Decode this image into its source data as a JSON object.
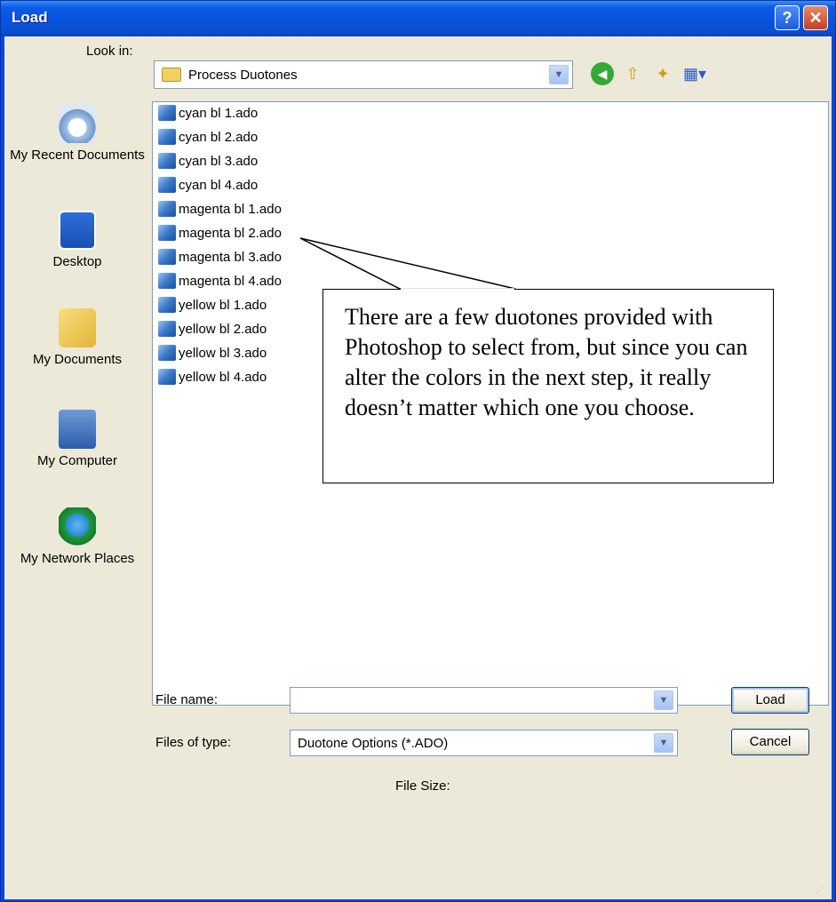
{
  "window": {
    "title": "Load"
  },
  "toolbar": {
    "look_in_label": "Look in:",
    "look_in_value": "Process Duotones"
  },
  "places": [
    {
      "label": "My Recent Documents",
      "icon": "recent-documents-icon"
    },
    {
      "label": "Desktop",
      "icon": "desktop-icon"
    },
    {
      "label": "My Documents",
      "icon": "my-documents-icon"
    },
    {
      "label": "My Computer",
      "icon": "my-computer-icon"
    },
    {
      "label": "My Network Places",
      "icon": "network-places-icon"
    }
  ],
  "files": [
    "cyan bl 1.ado",
    "cyan bl 2.ado",
    "cyan bl 3.ado",
    "cyan bl 4.ado",
    "magenta bl 1.ado",
    "magenta bl 2.ado",
    "magenta bl 3.ado",
    "magenta bl 4.ado",
    "yellow bl 1.ado",
    "yellow bl 2.ado",
    "yellow bl 3.ado",
    "yellow bl 4.ado"
  ],
  "callout": {
    "text": "There are a few duotones provided with Photoshop to select from, but since you can alter the colors in the next step, it really doesn’t matter which one you choose."
  },
  "form": {
    "file_name_label": "File name:",
    "file_name_value": "",
    "files_of_type_label": "Files of type:",
    "files_of_type_value": "Duotone Options (*.ADO)",
    "file_size_label": "File Size:"
  },
  "buttons": {
    "load": "Load",
    "cancel": "Cancel"
  },
  "colors": {
    "titlebar": "#0a5ce6",
    "dialog_bg": "#ece9d8",
    "accent_border": "#7f9db9"
  }
}
